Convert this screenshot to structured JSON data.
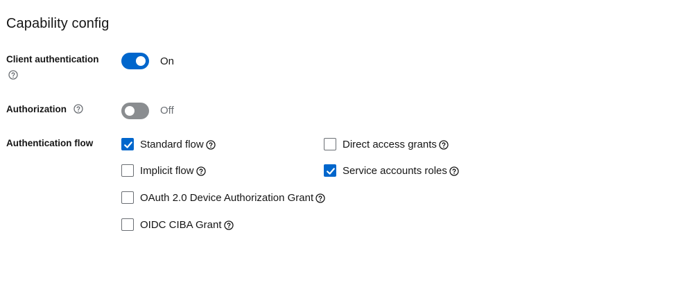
{
  "section": {
    "title": "Capability config"
  },
  "client_authentication": {
    "label": "Client authentication",
    "state": true,
    "state_text": "On"
  },
  "authorization": {
    "label": "Authorization",
    "state": false,
    "state_text": "Off"
  },
  "authentication_flow": {
    "label": "Authentication flow",
    "options": {
      "standard_flow": {
        "label": "Standard flow",
        "checked": true
      },
      "direct_access_grants": {
        "label": "Direct access grants",
        "checked": false
      },
      "implicit_flow": {
        "label": "Implicit flow",
        "checked": false
      },
      "service_accounts_roles": {
        "label": "Service accounts roles",
        "checked": true
      },
      "oauth_device_grant": {
        "label": "OAuth 2.0 Device Authorization Grant",
        "checked": false
      },
      "oidc_ciba_grant": {
        "label": "OIDC CIBA Grant",
        "checked": false
      }
    }
  },
  "colors": {
    "accent": "#0066cc",
    "switch_off": "#8a8d90",
    "text": "#151515",
    "muted_text": "#6a6e73"
  },
  "icons": {
    "help": "help-circle-icon",
    "check": "check-icon"
  }
}
